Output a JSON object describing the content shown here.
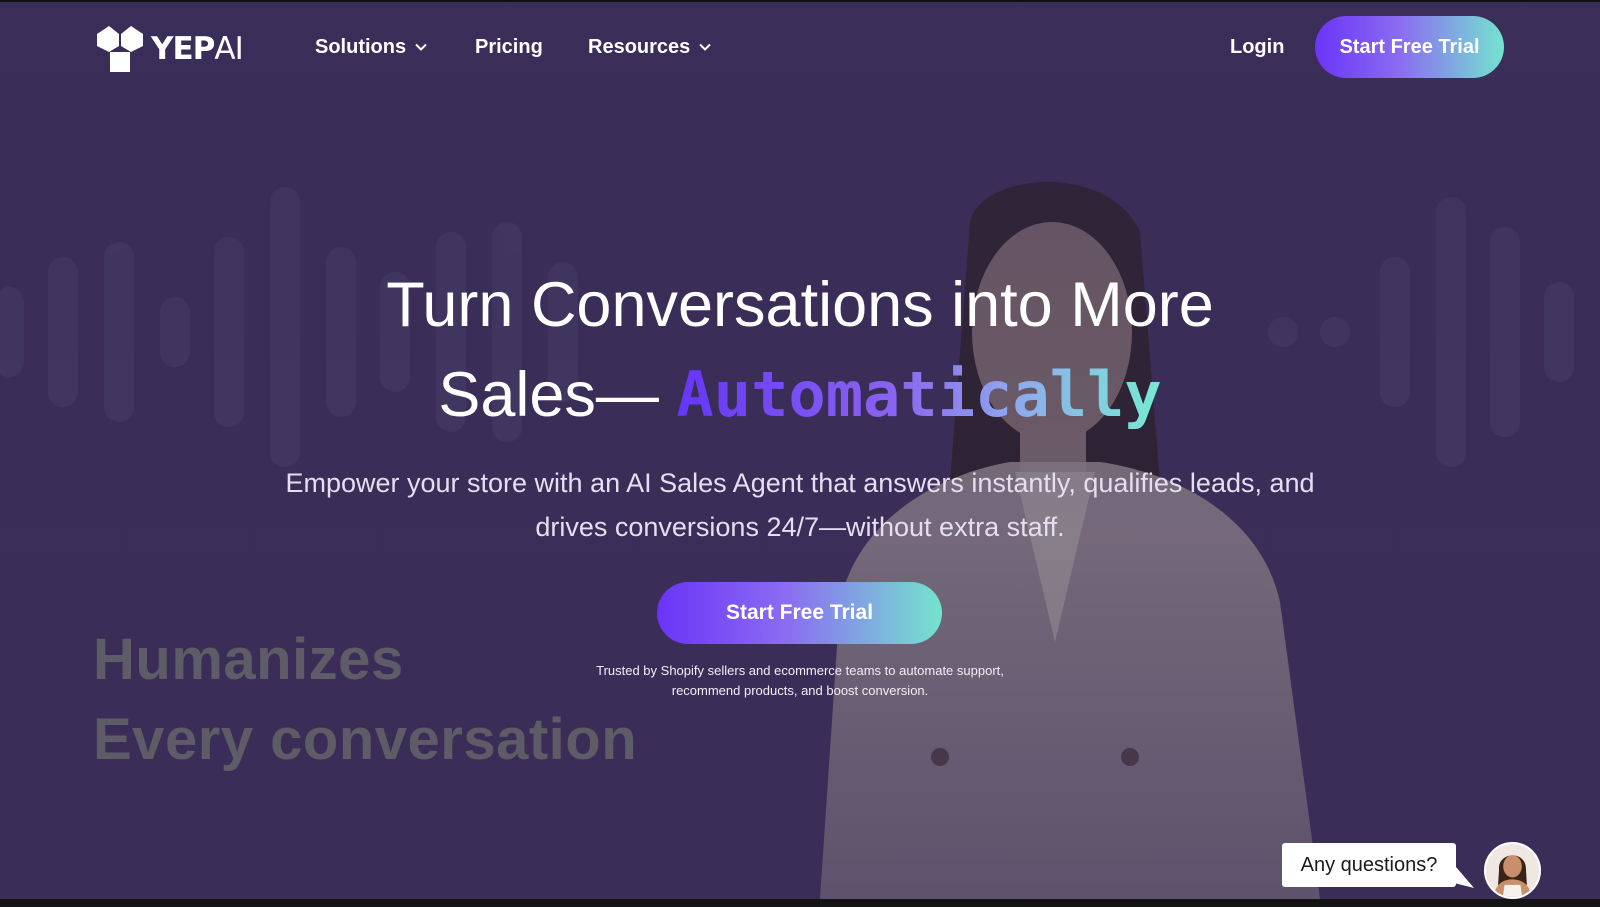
{
  "brand": {
    "bold": "YEP",
    "light": "AI"
  },
  "nav": {
    "solutions": "Solutions",
    "pricing": "Pricing",
    "resources": "Resources",
    "login": "Login",
    "cta": "Start Free Trial"
  },
  "hero": {
    "title_line1": "Turn Conversations into More",
    "title_line2_prefix": "Sales— ",
    "title_highlight": "Automatically",
    "subtitle": "Empower your store with an AI Sales Agent that answers instantly, qualifies leads, and drives conversions 24/7—without extra staff.",
    "cta": "Start Free Trial",
    "trust_line1": "Trusted by Shopify sellers and ecommerce teams to automate support,",
    "trust_line2": "recommend products, and boost conversion."
  },
  "background_text": {
    "line1": "Humanizes",
    "line2": "Every conversation"
  },
  "chat": {
    "prompt": "Any questions?"
  },
  "colors": {
    "background": "#3a2f58",
    "gradient_start": "#6a34f7",
    "gradient_end": "#74e3cf",
    "text": "#ffffff"
  },
  "icons": [
    "yepai-logo-icon",
    "chevron-down-icon",
    "avatar"
  ]
}
